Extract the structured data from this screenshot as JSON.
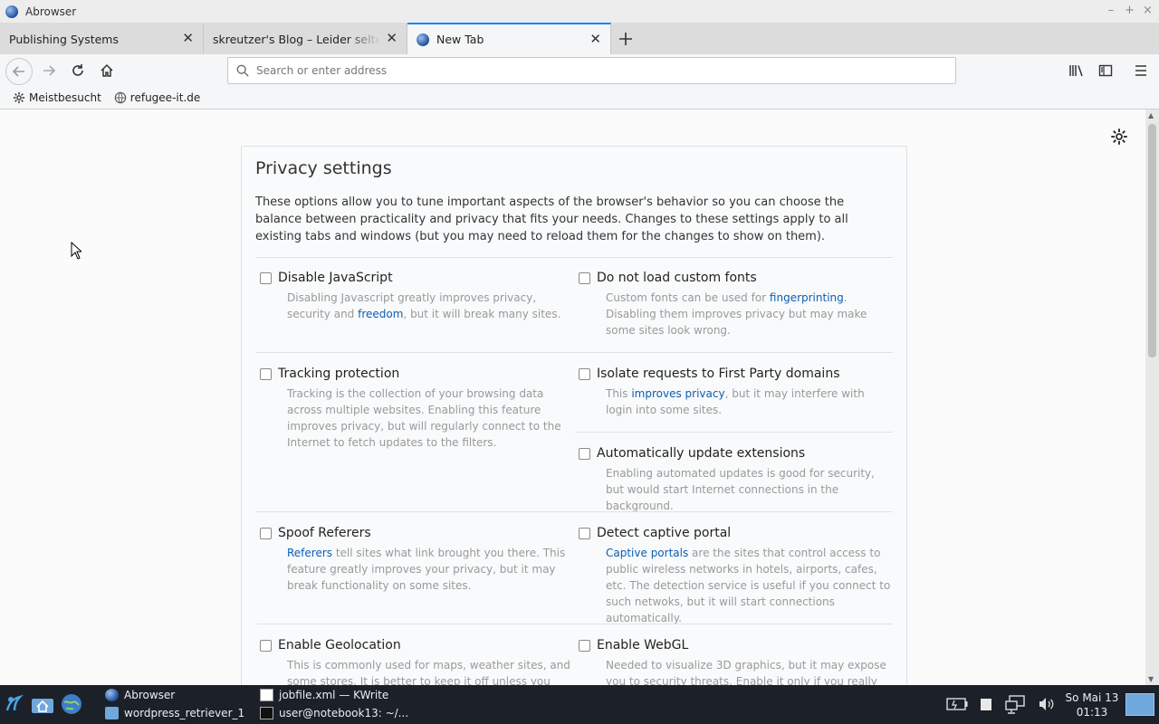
{
  "window": {
    "title": "Abrowser",
    "controls": [
      "–",
      "+",
      "×"
    ]
  },
  "tabs": [
    {
      "label": "Publishing Systems",
      "active": false
    },
    {
      "label": "skreutzer's Blog – Leider selten erfüllt",
      "active": false
    },
    {
      "label": "New Tab",
      "active": true
    }
  ],
  "toolbar": {
    "address_placeholder": "Search or enter address"
  },
  "bookmarks": [
    {
      "label": "Meistbesucht",
      "icon": "gear-icon"
    },
    {
      "label": "refugee-it.de",
      "icon": "globe-icon"
    }
  ],
  "privacy": {
    "title": "Privacy settings",
    "intro": "These options allow you to tune important aspects of the browser's behavior so you can choose the balance between practicality and privacy that fits your needs. Changes to these settings apply to all existing tabs and windows (but you may need to reload them for the changes to show on them).",
    "options": {
      "disable_js": {
        "label": "Disable JavaScript",
        "desc_pre": "Disabling Javascript greatly improves privacy, security and ",
        "link": "freedom",
        "desc_post": ", but it will break many sites."
      },
      "custom_fonts": {
        "label": "Do not load custom fonts",
        "desc_pre": "Custom fonts can be used for ",
        "link": "fingerprinting",
        "desc_post": ". Disabling them improves privacy but may make some sites look wrong."
      },
      "tracking": {
        "label": "Tracking protection",
        "desc": "Tracking is the collection of your browsing data across multiple websites. Enabling this feature improves privacy, but will regularly connect to the Internet to fetch updates to the filters."
      },
      "isolate": {
        "label": "Isolate requests to First Party domains",
        "desc_pre": "This ",
        "link": "improves privacy",
        "desc_post": ", but it may interfere with login into some sites."
      },
      "auto_update": {
        "label": "Automatically update extensions",
        "desc": "Enabling automated updates is good for security, but would start Internet connections in the background."
      },
      "spoof_referers": {
        "label": "Spoof Referers",
        "link": "Referers",
        "desc_post": " tell sites what link brought you there. This feature greatly improves your privacy, but it may break functionality on some sites."
      },
      "captive_portal": {
        "label": "Detect captive portal",
        "link": "Captive portals",
        "desc_post": " are the sites that control access to public wireless networks in hotels, airports, cafes, etc. The detection service is useful if you connect to such netwoks, but it will start connections automatically."
      },
      "geolocation": {
        "label": "Enable Geolocation",
        "desc": "This is commonly used for maps, weather sites, and some stores. It is better to keep it off unless you really"
      },
      "webgl": {
        "label": "Enable WebGL",
        "desc": "Needed to visualize 3D graphics, but it may expose you to security threats. Enable it only if you really use it."
      }
    }
  },
  "taskbar": {
    "tasks": [
      {
        "label": "Abrowser"
      },
      {
        "label": "wordpress_retriever_1"
      },
      {
        "label": "jobfile.xml — KWrite"
      },
      {
        "label": "user@notebook13: ~/..."
      }
    ],
    "clock_date": "So Mai 13",
    "clock_time": "01:13"
  }
}
